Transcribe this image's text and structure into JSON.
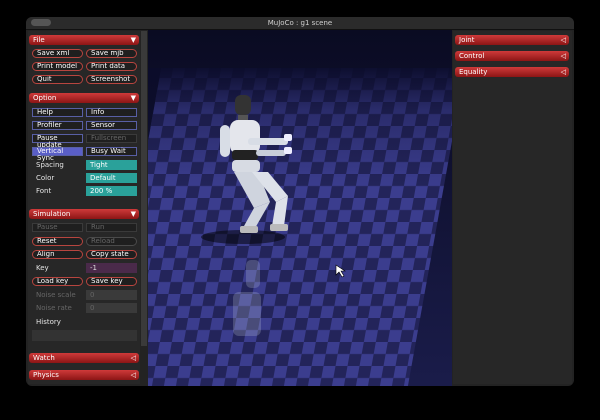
{
  "window": {
    "title": "MuJoCo : g1 scene"
  },
  "file": {
    "header": "File",
    "buttons": [
      "Save xml",
      "Save mjb",
      "Print model",
      "Print data",
      "Quit",
      "Screenshot"
    ]
  },
  "option": {
    "header": "Option",
    "toggles": [
      "Help",
      "Info",
      "Profiler",
      "Sensor",
      "Pause update",
      "Fullscreen",
      "Vertical Sync",
      "Busy Wait"
    ],
    "spacing_label": "Spacing",
    "spacing_value": "Tight",
    "color_label": "Color",
    "color_value": "Default",
    "font_label": "Font",
    "font_value": "200 %"
  },
  "simulation": {
    "header": "Simulation",
    "pause": "Pause",
    "run": "Run",
    "reset": "Reset",
    "reload": "Reload",
    "align": "Align",
    "copy_state": "Copy state",
    "key_label": "Key",
    "key_value": "-1",
    "load_key": "Load key",
    "save_key": "Save key",
    "noise_scale_label": "Noise scale",
    "noise_scale_value": "0",
    "noise_rate_label": "Noise rate",
    "noise_rate_value": "0",
    "history_label": "History"
  },
  "bottom": {
    "watch": "Watch",
    "physics": "Physics"
  },
  "right": {
    "joint": "Joint",
    "control": "Control",
    "equality": "Equality"
  },
  "icons": {
    "expanded": "▼",
    "collapsed": "◁"
  },
  "colors": {
    "accent": "#b02020",
    "radio_on": "#5a5fc7",
    "select": "#2aa19a",
    "floor_a": "#3b3d8e",
    "floor_b": "#23245a"
  }
}
